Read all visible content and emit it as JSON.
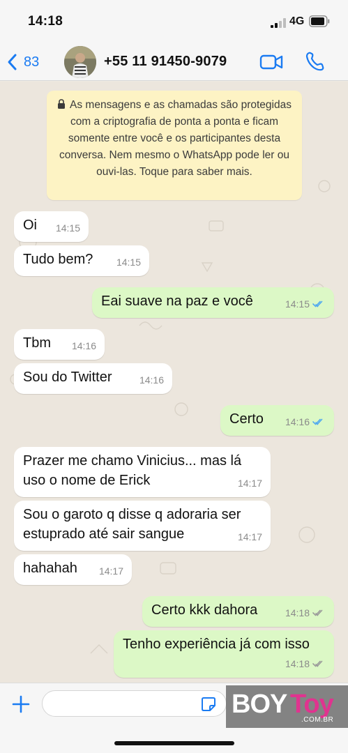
{
  "status_bar": {
    "time": "14:18",
    "network": "4G"
  },
  "header": {
    "back_count": "83",
    "contact_name": "+55 11 91450-9079"
  },
  "encryption_notice": "As mensagens e as chamadas são protegidas com a criptografia de ponta a ponta e ficam somente entre você e os participantes desta conversa. Nem mesmo o WhatsApp pode ler ou ouvi-las. Toque para saber mais.",
  "messages": [
    {
      "direction": "in",
      "text": "Oi",
      "time": "14:15"
    },
    {
      "direction": "in",
      "text": "Tudo bem?",
      "time": "14:15"
    },
    {
      "direction": "out",
      "text": "Eai suave na paz e você",
      "time": "14:15",
      "status": "read"
    },
    {
      "direction": "in",
      "text": "Tbm",
      "time": "14:16"
    },
    {
      "direction": "in",
      "text": "Sou do Twitter",
      "time": "14:16"
    },
    {
      "direction": "out",
      "text": "Certo",
      "time": "14:16",
      "status": "read"
    },
    {
      "direction": "in",
      "text": "Prazer me chamo Vinicius... mas lá uso o nome de Erick",
      "time": "14:17"
    },
    {
      "direction": "in",
      "text": "Sou o garoto q disse q adoraria ser estuprado até sair sangue",
      "time": "14:17"
    },
    {
      "direction": "in",
      "text": "hahahah",
      "time": "14:17"
    },
    {
      "direction": "out",
      "text": "Certo kkk dahora",
      "time": "14:18",
      "status": "delivered"
    },
    {
      "direction": "out",
      "text": "Tenho experiência já com isso",
      "time": "14:18",
      "status": "delivered"
    }
  ],
  "input": {
    "value": "",
    "placeholder": ""
  },
  "watermark": {
    "brand_part1": "BOY",
    "brand_part2": "Toy",
    "domain": ".COM.BR"
  },
  "colors": {
    "accent": "#1a7bf2",
    "outgoing_bubble": "#dcf8c6",
    "incoming_bubble": "#ffffff",
    "notice_bg": "#fdf3c4",
    "read_ticks": "#4fa8f0",
    "delivered_ticks": "#9a9a9a",
    "chat_bg": "#ece6dd"
  },
  "icons": [
    "back-chevron-icon",
    "video-call-icon",
    "phone-call-icon",
    "lock-icon",
    "plus-icon",
    "sticker-icon",
    "read-ticks-icon",
    "delivered-ticks-icon",
    "signal-icon",
    "battery-icon"
  ]
}
